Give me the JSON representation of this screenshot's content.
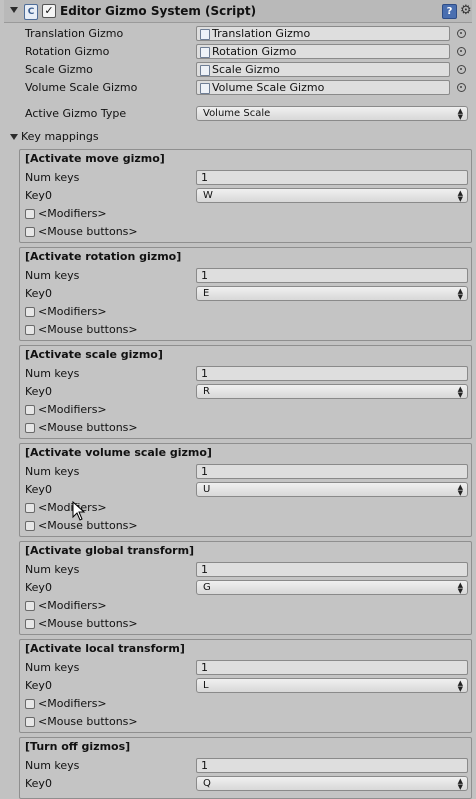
{
  "header": {
    "fold_icon": "triangle-down-icon",
    "script_icon": "cs-script-icon",
    "enabled": true,
    "title": "Editor Gizmo System (Script)",
    "help_icon": "help-book-icon",
    "gear_icon": "gear-icon"
  },
  "gizmos": [
    {
      "label": "Translation Gizmo",
      "value": "Translation Gizmo"
    },
    {
      "label": "Rotation Gizmo",
      "value": "Rotation Gizmo"
    },
    {
      "label": "Scale Gizmo",
      "value": "Scale Gizmo"
    },
    {
      "label": "Volume Scale Gizmo",
      "value": "Volume Scale Gizmo"
    }
  ],
  "active_gizmo": {
    "label": "Active Gizmo Type",
    "value": "Volume Scale"
  },
  "key_mappings": {
    "label": "Key mappings",
    "field_labels": {
      "num_keys": "Num keys",
      "key0": "Key0",
      "modifiers": "<Modifiers>",
      "mouse_buttons": "<Mouse buttons>"
    },
    "groups": [
      {
        "title": "[Activate move gizmo]",
        "num_keys": "1",
        "key0": "W"
      },
      {
        "title": "[Activate rotation gizmo]",
        "num_keys": "1",
        "key0": "E"
      },
      {
        "title": "[Activate scale gizmo]",
        "num_keys": "1",
        "key0": "R"
      },
      {
        "title": "[Activate volume scale gizmo]",
        "num_keys": "1",
        "key0": "U"
      },
      {
        "title": "[Activate global transform]",
        "num_keys": "1",
        "key0": "G"
      },
      {
        "title": "[Activate local transform]",
        "num_keys": "1",
        "key0": "L"
      },
      {
        "title": "[Turn off gizmos]",
        "num_keys": "1",
        "key0": "Q"
      }
    ]
  }
}
